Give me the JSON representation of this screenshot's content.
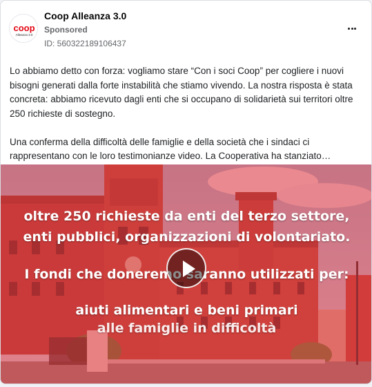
{
  "post": {
    "page_name": "Coop Alleanza 3.0",
    "sponsored_label": "Sponsored",
    "ad_id": "ID: 560322189106437",
    "avatar_logo_text": "coop",
    "avatar_logo_subtext": "Alleanza 3.0",
    "paragraphs": [
      "Lo abbiamo detto con forza: vogliamo stare “Con i soci Coop” per cogliere i nuovi bisogni generati dalla forte instabilità che stiamo vivendo. La nostra risposta è stata concreta: abbiamo ricevuto dagli enti che si occupano di solidarietà sui territori oltre 250 richieste di sostegno.",
      "Una conferma della difficoltà delle famiglie e della società che i sindaci ci rappresentano con le loro testimonianze video. La Cooperativa ha stanziato…"
    ]
  },
  "video": {
    "overlay_line1_highlight": "oltre 250 richieste",
    "overlay_line1_rest": " da enti del terzo settore,",
    "overlay_line2": "enti pubblici, organizzazioni di volontariato.",
    "overlay_line3": "I fondi che doneremo saranno utilizzati per:",
    "overlay_line4": "aiuti alimentari e beni primari",
    "overlay_line5": "alle famiglie in difficoltà"
  },
  "colors": {
    "brand_red": "#e30613",
    "overlay_red": "#e8323a",
    "meta_gray": "#65676b"
  },
  "icons": {
    "more": "more-horizontal-icon",
    "play": "play-icon"
  }
}
